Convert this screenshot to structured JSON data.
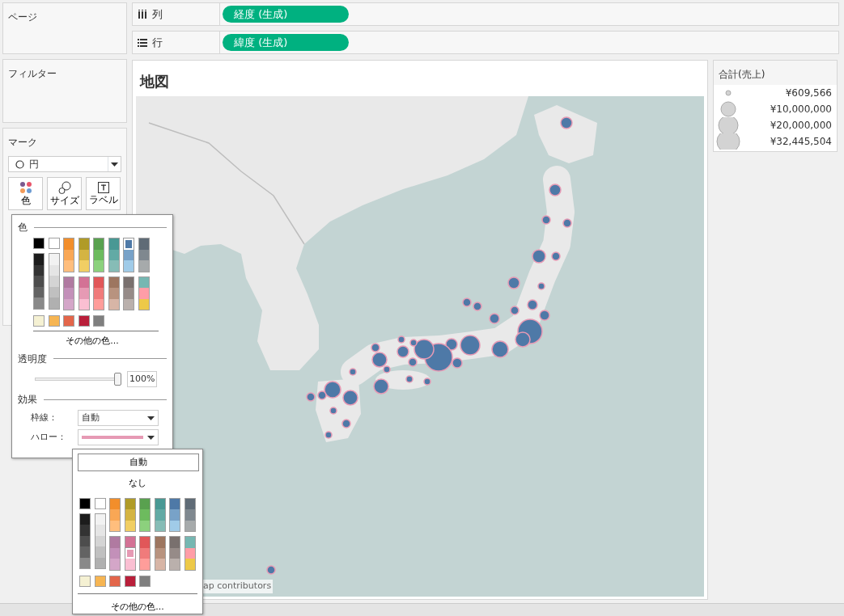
{
  "shelves": {
    "pages": {
      "title": "ページ"
    },
    "filters": {
      "title": "フィルター"
    },
    "marks": {
      "title": "マーク",
      "mark_type": "円",
      "buttons": [
        {
          "label": "色",
          "kind": "color"
        },
        {
          "label": "サイズ",
          "kind": "size"
        },
        {
          "label": "ラベル",
          "kind": "label"
        }
      ]
    }
  },
  "columns_shelf": {
    "label": "列",
    "pill": "経度 (生成)"
  },
  "rows_shelf": {
    "label": "行",
    "pill": "緯度 (生成)"
  },
  "sheet": {
    "title": "地図",
    "attribution": "ap contributors"
  },
  "legend": {
    "title": "合計(売上)",
    "items": [
      {
        "label": "¥609,566"
      },
      {
        "label": "¥10,000,000"
      },
      {
        "label": "¥20,000,000"
      },
      {
        "label": "¥32,445,504"
      }
    ]
  },
  "color_popup": {
    "heading": "色",
    "palette": {
      "mono": [
        {
          "head": {
            "color": "#000000",
            "selected": false
          },
          "shades": [
            {
              "color": "#1c1c1c",
              "selected": false
            },
            {
              "color": "#333333",
              "selected": false
            },
            {
              "color": "#4d4d4d",
              "selected": false
            },
            {
              "color": "#636363",
              "selected": false
            },
            {
              "color": "#898989",
              "selected": false
            }
          ]
        },
        {
          "head": {
            "color": "#ffffff",
            "selected": false
          },
          "shades": [
            {
              "color": "#f2f2f2",
              "selected": false
            },
            {
              "color": "#e5e5e5",
              "selected": false
            },
            {
              "color": "#d4d4d4",
              "selected": false
            },
            {
              "color": "#c0c0c0",
              "selected": false
            },
            {
              "color": "#b0b0b0",
              "selected": false
            }
          ]
        }
      ],
      "top": [
        [
          {
            "color": "#f28e2b",
            "selected": false
          },
          {
            "color": "#f9a755",
            "selected": false
          },
          {
            "color": "#ffbe7d",
            "selected": false
          }
        ],
        [
          {
            "color": "#b09b28",
            "selected": false
          },
          {
            "color": "#d4b443",
            "selected": false
          },
          {
            "color": "#f1ce63",
            "selected": false
          }
        ],
        [
          {
            "color": "#59a14f",
            "selected": false
          },
          {
            "color": "#6dbb5e",
            "selected": false
          },
          {
            "color": "#8cd17d",
            "selected": false
          }
        ],
        [
          {
            "color": "#499894",
            "selected": false
          },
          {
            "color": "#62aaa5",
            "selected": false
          },
          {
            "color": "#86bcb6",
            "selected": false
          }
        ],
        [
          {
            "color": "#4e79a7",
            "selected": true
          },
          {
            "color": "#78a2c8",
            "selected": false
          },
          {
            "color": "#a0cbe8",
            "selected": false
          }
        ],
        [
          {
            "color": "#5f6b76",
            "selected": false
          },
          {
            "color": "#7f888f",
            "selected": false
          },
          {
            "color": "#a6aaab",
            "selected": false
          }
        ]
      ],
      "bottom": [
        [
          {
            "color": "#b07aa1",
            "selected": false
          },
          {
            "color": "#c390b9",
            "selected": false
          },
          {
            "color": "#d4a6c8",
            "selected": false
          }
        ],
        [
          {
            "color": "#d37295",
            "selected": false
          },
          {
            "color": "#e69ab4",
            "selected": false
          },
          {
            "color": "#fabfd2",
            "selected": false
          }
        ],
        [
          {
            "color": "#e15759",
            "selected": false
          },
          {
            "color": "#f07b7b",
            "selected": false
          },
          {
            "color": "#ff9d9a",
            "selected": false
          }
        ],
        [
          {
            "color": "#9d7660",
            "selected": false
          },
          {
            "color": "#b8937f",
            "selected": false
          },
          {
            "color": "#d7b5a6",
            "selected": false
          }
        ],
        [
          {
            "color": "#79706e",
            "selected": false
          },
          {
            "color": "#968b88",
            "selected": false
          },
          {
            "color": "#bab0ac",
            "selected": false
          }
        ],
        [
          {
            "color": "#76b7b2",
            "selected": false
          },
          {
            "color": "#ff9da7",
            "selected": false
          },
          {
            "color": "#edc948",
            "selected": false
          }
        ]
      ],
      "singles": [
        {
          "color": "#f5f1d3",
          "selected": false
        },
        {
          "color": "#f6b553",
          "selected": false
        },
        {
          "color": "#e3664a",
          "selected": false
        },
        {
          "color": "#b91f3a",
          "selected": false
        },
        {
          "color": "#7f7f7f",
          "selected": false
        }
      ]
    },
    "more_colors": "その他の色...",
    "opacity": {
      "heading": "透明度",
      "level": 1,
      "reading": "100%"
    },
    "effects": {
      "heading": "効果",
      "border": {
        "label": "枠線：",
        "value": "自動"
      },
      "halo": {
        "label": "ハロー：",
        "color": "#e69ab4"
      }
    }
  },
  "halo_popup": {
    "auto_button": "自動",
    "none_option": "なし",
    "palette": {
      "mono": [
        {
          "head": {
            "color": "#000000",
            "selected": false
          },
          "shades": [
            {
              "color": "#1c1c1c",
              "selected": false
            },
            {
              "color": "#333333",
              "selected": false
            },
            {
              "color": "#4d4d4d",
              "selected": false
            },
            {
              "color": "#636363",
              "selected": false
            },
            {
              "color": "#898989",
              "selected": false
            }
          ]
        },
        {
          "head": {
            "color": "#ffffff",
            "selected": false
          },
          "shades": [
            {
              "color": "#f2f2f2",
              "selected": false
            },
            {
              "color": "#e5e5e5",
              "selected": false
            },
            {
              "color": "#d4d4d4",
              "selected": false
            },
            {
              "color": "#c0c0c0",
              "selected": false
            },
            {
              "color": "#b0b0b0",
              "selected": false
            }
          ]
        }
      ],
      "top": [
        [
          {
            "color": "#f28e2b",
            "selected": false
          },
          {
            "color": "#f9a755",
            "selected": false
          },
          {
            "color": "#ffbe7d",
            "selected": false
          }
        ],
        [
          {
            "color": "#b09b28",
            "selected": false
          },
          {
            "color": "#d4b443",
            "selected": false
          },
          {
            "color": "#f1ce63",
            "selected": false
          }
        ],
        [
          {
            "color": "#59a14f",
            "selected": false
          },
          {
            "color": "#6dbb5e",
            "selected": false
          },
          {
            "color": "#8cd17d",
            "selected": false
          }
        ],
        [
          {
            "color": "#499894",
            "selected": false
          },
          {
            "color": "#62aaa5",
            "selected": false
          },
          {
            "color": "#86bcb6",
            "selected": false
          }
        ],
        [
          {
            "color": "#4e79a7",
            "selected": false
          },
          {
            "color": "#78a2c8",
            "selected": false
          },
          {
            "color": "#a0cbe8",
            "selected": false
          }
        ],
        [
          {
            "color": "#5f6b76",
            "selected": false
          },
          {
            "color": "#7f888f",
            "selected": false
          },
          {
            "color": "#a6aaab",
            "selected": false
          }
        ]
      ],
      "bottom": [
        [
          {
            "color": "#b07aa1",
            "selected": false
          },
          {
            "color": "#c390b9",
            "selected": false
          },
          {
            "color": "#d4a6c8",
            "selected": false
          }
        ],
        [
          {
            "color": "#d37295",
            "selected": false
          },
          {
            "color": "#e69ab4",
            "selected": true
          },
          {
            "color": "#fabfd2",
            "selected": false
          }
        ],
        [
          {
            "color": "#e15759",
            "selected": false
          },
          {
            "color": "#f07b7b",
            "selected": false
          },
          {
            "color": "#ff9d9a",
            "selected": false
          }
        ],
        [
          {
            "color": "#9d7660",
            "selected": false
          },
          {
            "color": "#b8937f",
            "selected": false
          },
          {
            "color": "#d7b5a6",
            "selected": false
          }
        ],
        [
          {
            "color": "#79706e",
            "selected": false
          },
          {
            "color": "#968b88",
            "selected": false
          },
          {
            "color": "#bab0ac",
            "selected": false
          }
        ],
        [
          {
            "color": "#76b7b2",
            "selected": false
          },
          {
            "color": "#ff9da7",
            "selected": false
          },
          {
            "color": "#edc948",
            "selected": false
          }
        ]
      ],
      "singles": [
        {
          "color": "#f5f1d3",
          "selected": false
        },
        {
          "color": "#f6b553",
          "selected": false
        },
        {
          "color": "#e3664a",
          "selected": false
        },
        {
          "color": "#b91f3a",
          "selected": false
        },
        {
          "color": "#7f7f7f",
          "selected": false
        }
      ]
    },
    "more_colors": "その他の色..."
  }
}
